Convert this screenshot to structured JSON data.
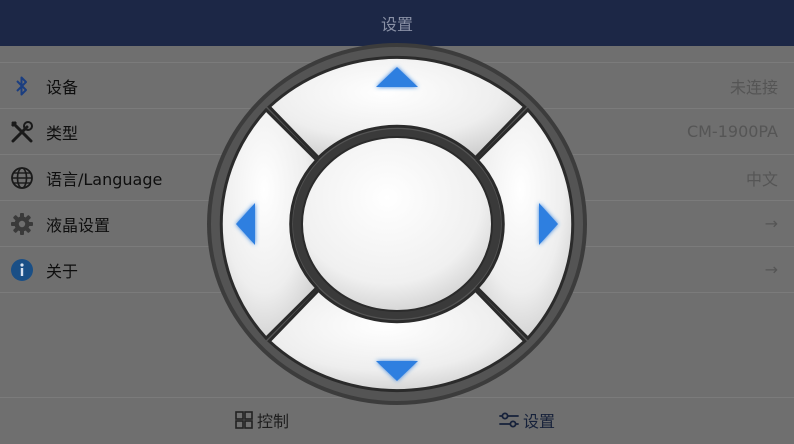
{
  "header": {
    "title": "设置"
  },
  "settings": {
    "items": [
      {
        "label": "设备",
        "value": "未连接",
        "icon": "bluetooth-icon"
      },
      {
        "label": "类型",
        "value": "CM-1900PA",
        "icon": "tools-icon"
      },
      {
        "label": "语言/Language",
        "value": "中文",
        "icon": "globe-icon"
      },
      {
        "label": "液晶设置",
        "value": "→",
        "icon": "gear-icon"
      },
      {
        "label": "关于",
        "value": "→",
        "icon": "info-icon"
      }
    ]
  },
  "bottom_nav": {
    "tabs": [
      {
        "label": "控制",
        "icon": "grid-icon",
        "active": false
      },
      {
        "label": "设置",
        "icon": "sliders-icon",
        "active": true
      }
    ]
  },
  "dpad": {
    "buttons": [
      "up",
      "down",
      "left",
      "right",
      "center"
    ],
    "arrow_color": "#2f7fe0"
  },
  "colors": {
    "header_bg": "#1c2746",
    "overlay_bg": "#6f6f6f",
    "accent": "#2f7fe0"
  }
}
